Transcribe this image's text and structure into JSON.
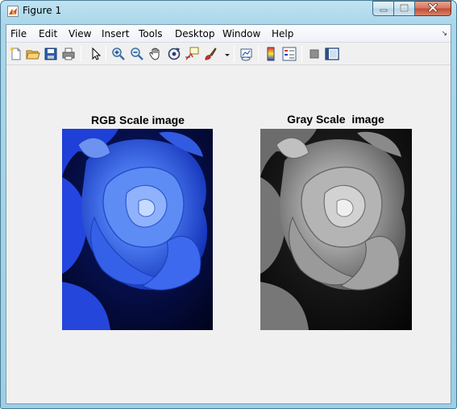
{
  "window": {
    "title": "Figure 1",
    "icon": "matlab-figure-icon",
    "controls": [
      "minimize-icon",
      "maximize-icon",
      "close-icon"
    ]
  },
  "menu": {
    "items": [
      "File",
      "Edit",
      "View",
      "Insert",
      "Tools",
      "Desktop",
      "Window",
      "Help"
    ],
    "dock_arrow_icon": "dock-arrow-icon"
  },
  "toolbar": {
    "icons": [
      "new-figure-icon",
      "open-file-icon",
      "save-icon",
      "print-icon",
      "edit-plot-arrow-icon",
      "zoom-in-icon",
      "zoom-out-icon",
      "pan-hand-icon",
      "rotate-3d-icon",
      "data-cursor-icon",
      "brush-icon",
      "brush-dropdown-icon",
      "link-plot-icon",
      "insert-colorbar-icon",
      "insert-legend-icon",
      "hide-plot-tools-icon",
      "show-plot-tools-icon"
    ]
  },
  "axes": [
    {
      "title": "RGB Scale image",
      "image": "blue-rose-photo"
    },
    {
      "title": "Gray Scale  image",
      "image": "grayscale-rose-photo"
    }
  ],
  "colors": {
    "figure_background": "#f0f0f0",
    "rose_blue": "#2a55e0",
    "close_button": "#c9503a"
  }
}
